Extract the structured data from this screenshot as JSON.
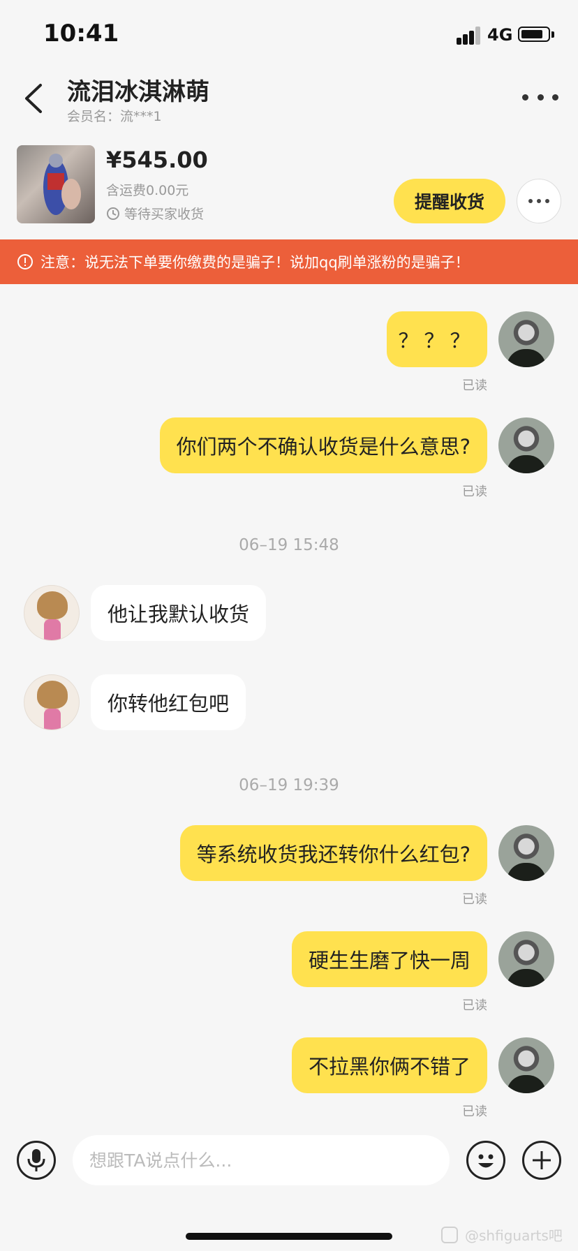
{
  "status_bar": {
    "time": "10:41",
    "network": "4G"
  },
  "header": {
    "title": "流泪冰淇淋萌",
    "subtitle": "会员名：流***1"
  },
  "product": {
    "price": "¥545.00",
    "shipping": "含运费0.00元",
    "status": "等待买家收货",
    "remind_button": "提醒收货"
  },
  "warning": {
    "text": "注意：说无法下单要你缴费的是骗子！说加qq刷单涨粉的是骗子！"
  },
  "chat": {
    "read_label": "已读",
    "messages": [
      {
        "sender": "me",
        "text": "？？？"
      },
      {
        "sender": "me",
        "text": "你们两个不确认收货是什么意思?"
      },
      {
        "sender": "other",
        "text": "他让我默认收货"
      },
      {
        "sender": "other",
        "text": "你转他红包吧"
      },
      {
        "sender": "me",
        "text": "等系统收货我还转你什么红包?"
      },
      {
        "sender": "me",
        "text": "硬生生磨了快一周"
      },
      {
        "sender": "me",
        "text": "不拉黑你俩不错了"
      }
    ],
    "timestamps": [
      "06–19 15:48",
      "06–19 19:39"
    ]
  },
  "input": {
    "placeholder": "想跟TA说点什么..."
  },
  "watermark": {
    "text": "@shfiguarts吧"
  },
  "colors": {
    "accent": "#ffe14f",
    "warning": "#ec5f3a",
    "background": "#f6f6f6"
  }
}
